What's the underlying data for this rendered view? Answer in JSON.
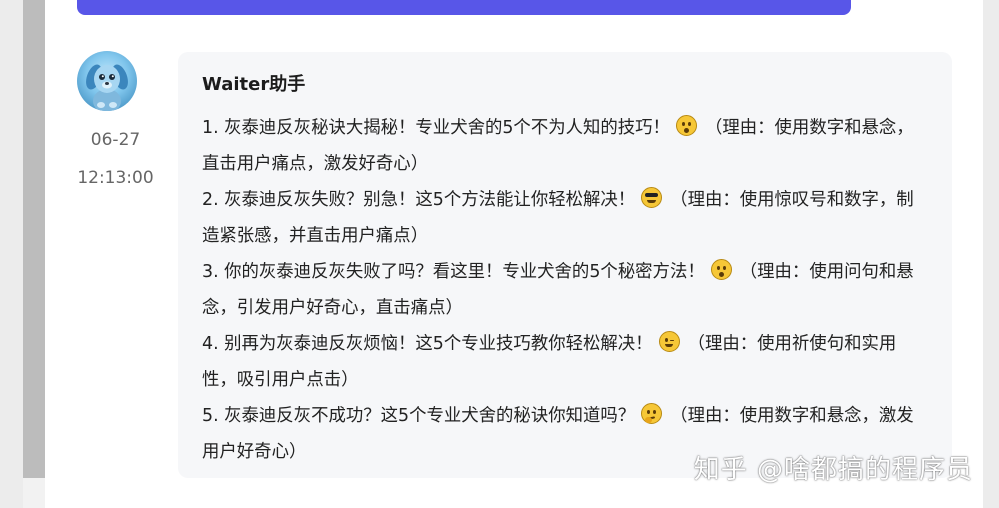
{
  "message": {
    "sender": "Waiter助手",
    "date": "06-27",
    "time": "12:13:00",
    "items": [
      {
        "text": "1. 灰泰迪反灰秘诀大揭秘！专业犬舍的5个不为人知的技巧！",
        "emoji": "astonished-face-icon",
        "reason": "（理由：使用数字和悬念，直击用户痛点，激发好奇心）"
      },
      {
        "text": "2. 灰泰迪反灰失败？别急！这5个方法能让你轻松解决！",
        "emoji": "sunglasses-face-icon",
        "reason": "（理由：使用惊叹号和数字，制造紧张感，并直击用户痛点）"
      },
      {
        "text": "3. 你的灰泰迪反灰失败了吗？看这里！专业犬舍的5个秘密方法！",
        "emoji": "hushed-face-icon",
        "reason": "（理由：使用问句和悬念，引发用户好奇心，直击痛点）"
      },
      {
        "text": "4. 别再为灰泰迪反灰烦恼！这5个专业技巧教你轻松解决！",
        "emoji": "winking-face-icon",
        "reason": "（理由：使用祈使句和实用性，吸引用户点击）"
      },
      {
        "text": "5. 灰泰迪反灰不成功？这5个专业犬舍的秘诀你知道吗？",
        "emoji": "thinking-face-icon",
        "reason": "（理由：使用数字和悬念，激发用户好奇心）"
      }
    ]
  },
  "watermark": "知乎 @啥都搞的程序员",
  "colors": {
    "accent": "#5856e8",
    "bubble_bg": "#f6f7f9",
    "meta_text": "#666666"
  }
}
